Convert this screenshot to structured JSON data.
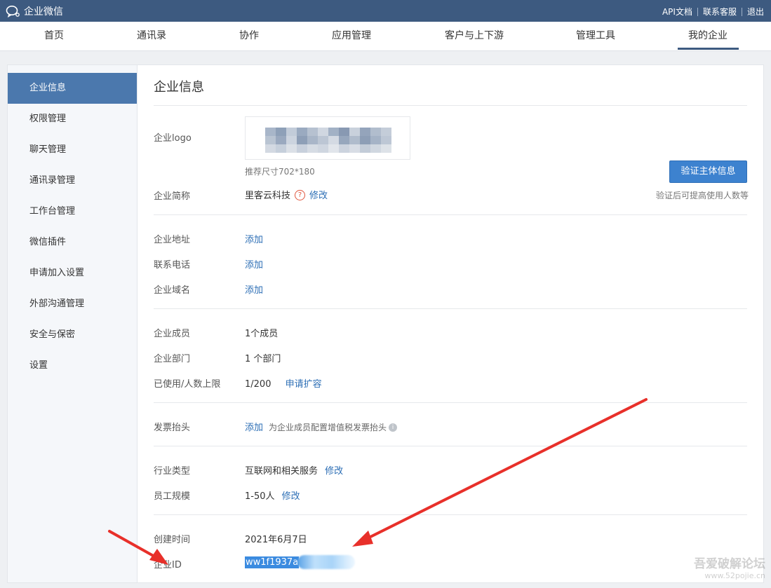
{
  "topbar": {
    "brand": "企业微信",
    "links": [
      "API文档",
      "联系客服",
      "退出"
    ]
  },
  "nav": {
    "items": [
      "首页",
      "通讯录",
      "协作",
      "应用管理",
      "客户与上下游",
      "管理工具",
      "我的企业"
    ],
    "active": "我的企业"
  },
  "sidebar": {
    "items": [
      "企业信息",
      "权限管理",
      "聊天管理",
      "通讯录管理",
      "工作台管理",
      "微信插件",
      "申请加入设置",
      "外部沟通管理",
      "安全与保密",
      "设置"
    ],
    "active": "企业信息"
  },
  "content": {
    "title": "企业信息",
    "logo": {
      "label": "企业logo",
      "hint": "推荐尺寸702*180"
    },
    "verify": {
      "button": "验证主体信息",
      "hint": "验证后可提高使用人数等"
    },
    "short_name": {
      "label": "企业简称",
      "value": "里客云科技",
      "help_icon": "?",
      "action": "修改"
    },
    "address": {
      "label": "企业地址",
      "action": "添加"
    },
    "phone": {
      "label": "联系电话",
      "action": "添加"
    },
    "domain": {
      "label": "企业域名",
      "action": "添加"
    },
    "members": {
      "label": "企业成员",
      "value": "1个成员"
    },
    "departments": {
      "label": "企业部门",
      "value": "1 个部门"
    },
    "usage": {
      "label": "已使用/人数上限",
      "value": "1/200",
      "action": "申请扩容"
    },
    "invoice": {
      "label": "发票抬头",
      "action": "添加",
      "note": "为企业成员配置增值税发票抬头",
      "info_icon": "i"
    },
    "industry": {
      "label": "行业类型",
      "value": "互联网和相关服务",
      "action": "修改"
    },
    "scale": {
      "label": "员工规模",
      "value": "1-50人",
      "action": "修改"
    },
    "created": {
      "label": "创建时间",
      "value": "2021年6月7日"
    },
    "corp_id": {
      "label": "企业ID",
      "value": "ww1f1937a"
    }
  },
  "watermark": {
    "text": "吾爱破解论坛",
    "url": "www.52pojie.cn"
  },
  "colors": {
    "topbar": "#3d5a80",
    "sidebar_active": "#4b78ad",
    "link": "#2c6eb5",
    "button": "#3d82cf",
    "arrow": "#e8302a"
  }
}
